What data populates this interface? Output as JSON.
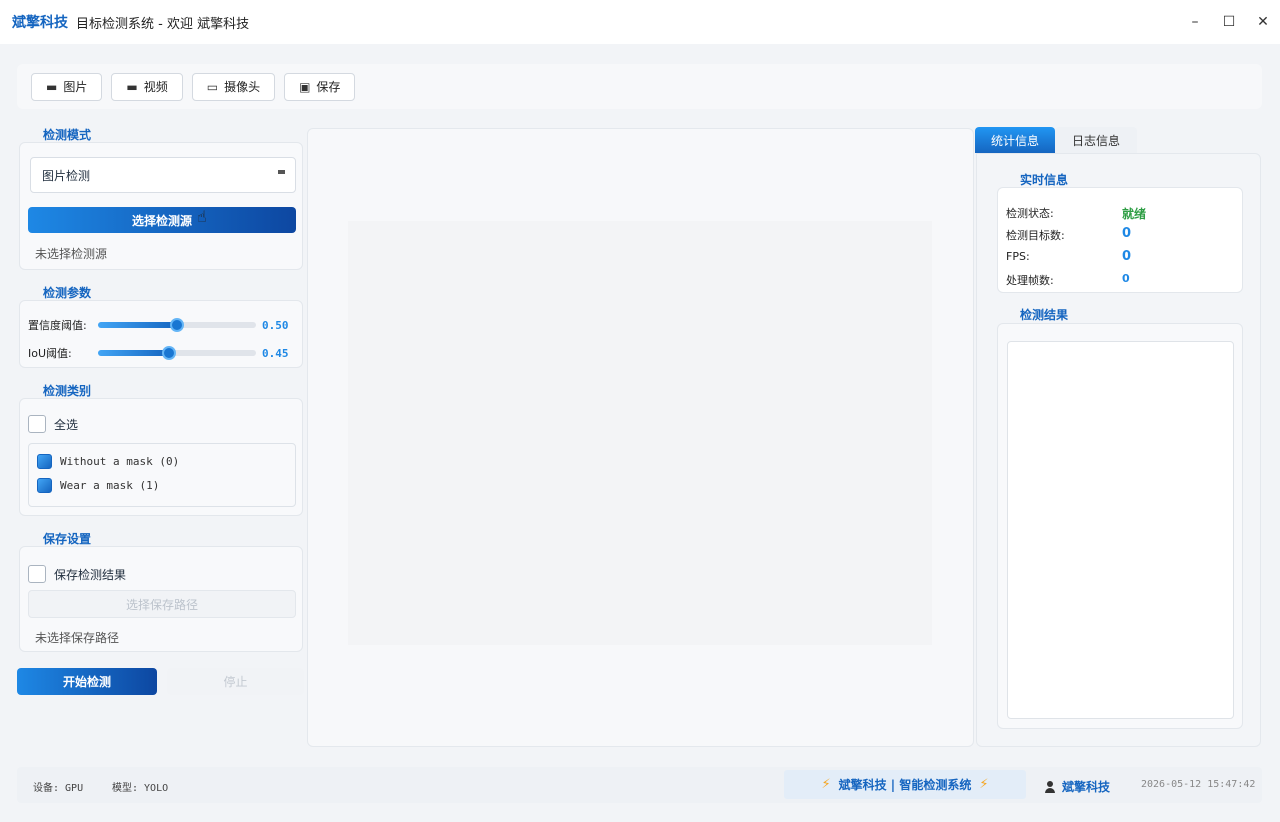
{
  "window": {
    "brand": "斌擎科技",
    "title": "目标检测系统 - 欢迎 斌擎科技",
    "controls": {
      "minimize": "–",
      "maximize": "☐",
      "close": "✕"
    }
  },
  "toolbar": {
    "items": [
      {
        "icon": "image-icon",
        "glyph": "▬",
        "label": "图片"
      },
      {
        "icon": "video-icon",
        "glyph": "▬",
        "label": "视频"
      },
      {
        "icon": "camera-icon",
        "glyph": "▭",
        "label": "摄像头"
      },
      {
        "icon": "save-icon",
        "glyph": "▣",
        "label": "保存"
      }
    ]
  },
  "detect_mode": {
    "title": "检测模式",
    "selected": "图片检测",
    "select_button": "选择检测源",
    "source_status": "未选择检测源"
  },
  "detect_params": {
    "title": "检测参数",
    "confidence": {
      "label": "置信度阈值:",
      "value": "0.50",
      "fraction": 0.5
    },
    "iou": {
      "label": "IoU阈值:",
      "value": "0.45",
      "fraction": 0.45
    }
  },
  "detect_classes": {
    "title": "检测类别",
    "select_all": "全选",
    "items": [
      {
        "label": "Without a mask (0)",
        "checked": true
      },
      {
        "label": "Wear a mask (1)",
        "checked": true
      }
    ]
  },
  "save_settings": {
    "title": "保存设置",
    "save_results": "保存检测结果",
    "choose_path": "选择保存路径",
    "path_status": "未选择保存路径"
  },
  "actions": {
    "start": "开始检测",
    "stop": "停止"
  },
  "tabs": {
    "stats": "统计信息",
    "log": "日志信息"
  },
  "realtime": {
    "title": "实时信息",
    "rows": [
      {
        "label": "检测状态:",
        "value": "就绪",
        "color": "#2e9e44"
      },
      {
        "label": "检测目标数:",
        "value": "0",
        "color": "#1e88e5"
      },
      {
        "label": "FPS:",
        "value": "0",
        "color": "#1e88e5"
      },
      {
        "label": "处理帧数:",
        "value": "0",
        "color": "#1e88e5"
      }
    ]
  },
  "results": {
    "title": "检测结果"
  },
  "statusbar": {
    "device": "设备: GPU",
    "model": "模型: YOLO",
    "center": "斌擎科技 | 智能检测系统",
    "user": "斌擎科技",
    "datetime": "2026-05-12 15:47:42"
  },
  "colors": {
    "accent": "#1565c0",
    "accent_light": "#1e88e5",
    "bolt": "#f5a623"
  }
}
